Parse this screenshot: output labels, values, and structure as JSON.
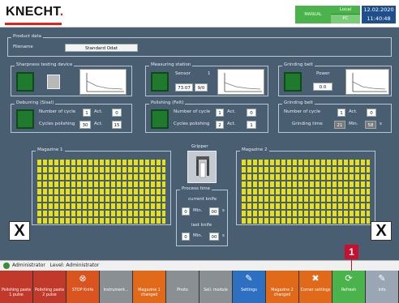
{
  "header": {
    "logo": "KNECHT",
    "logo_dot": ".",
    "mode": "MANUAL",
    "local": "Local",
    "pc": "PC",
    "date": "12.02.2020",
    "time": "11:40:48"
  },
  "product_data": {
    "title": "Product data",
    "filename_label": "Filename",
    "filename_value": "Standard Odat"
  },
  "sharpness": {
    "title": "Sharpness testing device"
  },
  "measuring": {
    "title": "Measuring station",
    "sensor_label": "Sensor",
    "sensor_value": "1",
    "value_a": "73.07",
    "value_b": "9/0"
  },
  "grinding_belt_top": {
    "title": "Grinding belt",
    "power_label": "Power",
    "power_value": "0.0"
  },
  "deburring": {
    "title": "Deburring (Sisal)",
    "cycles_label": "Number of cycle",
    "cycles_value": "1",
    "act_label": "Act.",
    "cycles_act": "0",
    "polishing_label": "Cycles polishing",
    "polishing_value": "30",
    "polishing_act_label": "Act.",
    "polishing_act": "15"
  },
  "polishing": {
    "title": "Polishing (Felt)",
    "cycles_label": "Number of cycle",
    "cycles_value": "1",
    "act_label": "Act.",
    "cycles_act": "0",
    "polishing_label": "Cycles polishing",
    "polishing_value": "2",
    "polishing_act_label": "Act.",
    "polishing_act": "1"
  },
  "grinding_belt": {
    "title": "Grinding belt",
    "cycles_label": "Number of cycle",
    "cycles_value": "1",
    "act_label": "Act.",
    "cycles_act": "0",
    "time_label": "Grinding time",
    "time_min": "21",
    "min_label": "Min.",
    "time_sec": "58",
    "sec_label": "s"
  },
  "magazine1": {
    "title": "Magazine 1"
  },
  "magazine2": {
    "title": "Magazine 2"
  },
  "gripper": {
    "title": "Gripper"
  },
  "process_time": {
    "title": "Process time",
    "current_label": "current knife",
    "current_min": "0",
    "current_sec": "00",
    "last_label": "last knife",
    "last_min": "0",
    "last_sec": "00",
    "min_label": "Min.",
    "sec_label": "s"
  },
  "close_left": "X",
  "close_right": "X",
  "status": {
    "user": "Administrator",
    "level": "Level: Administrator"
  },
  "callout": "1",
  "buttons": [
    {
      "label": "Polishing paste 1 pulse",
      "color": "#c0392b",
      "icon": ""
    },
    {
      "label": "Polishing paste 2 pulse",
      "color": "#c0392b",
      "icon": ""
    },
    {
      "label": "STOP Knife",
      "color": "#d9541e",
      "icon": "⊗"
    },
    {
      "label": "Instrument...",
      "color": "#8a8f94",
      "icon": ""
    },
    {
      "label": "Magazine 1 changed",
      "color": "#e06a1a",
      "icon": ""
    },
    {
      "label": "Photo",
      "color": "#8a8f94",
      "icon": ""
    },
    {
      "label": "Sell. module",
      "color": "#8a8f94",
      "icon": ""
    },
    {
      "label": "Settings",
      "color": "#2d6fc0",
      "icon": "✎"
    },
    {
      "label": "Magazine 2 changed",
      "color": "#e06a1a",
      "icon": ""
    },
    {
      "label": "Corner settings",
      "color": "#e06a1a",
      "icon": "✖"
    },
    {
      "label": "Refresh",
      "color": "#4bb34b",
      "icon": "⟳"
    },
    {
      "label": "Info",
      "color": "#9aa6b4",
      "icon": "✎"
    }
  ]
}
